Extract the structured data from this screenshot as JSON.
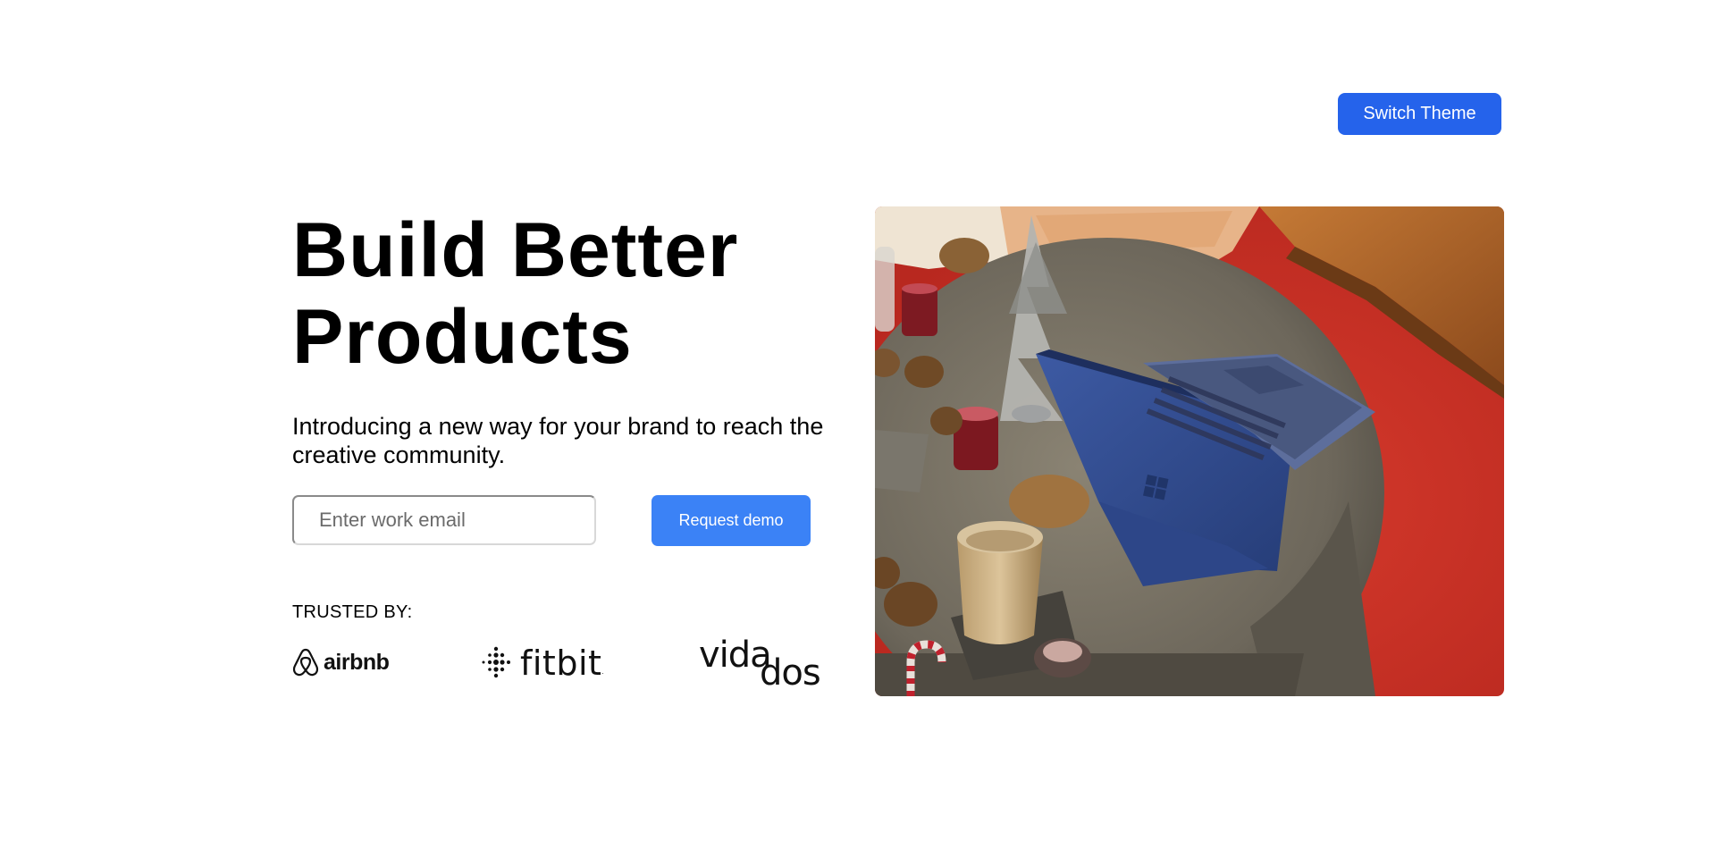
{
  "header": {
    "theme_button_label": "Switch Theme"
  },
  "hero": {
    "title_line1": "Build Better",
    "title_line2": "Products",
    "subtitle": "Introducing a new way for your brand to reach the creative community."
  },
  "form": {
    "email_placeholder": "Enter work email",
    "email_value": "",
    "submit_label": "Request demo"
  },
  "trusted": {
    "label": "TRUSTED BY:",
    "logos": [
      {
        "name": "airbnb",
        "icon": "airbnb-logo"
      },
      {
        "name": "fitbit",
        "icon": "fitbit-logo"
      },
      {
        "name": "vidados",
        "icon": "vidados-logo"
      }
    ]
  },
  "image": {
    "alt": "Blue laptop tablet on a round concrete table with pine cones and small holiday decorations"
  },
  "colors": {
    "primary": "#2563eb",
    "button_secondary": "#3b82f6",
    "text": "#000000",
    "background": "#ffffff"
  }
}
